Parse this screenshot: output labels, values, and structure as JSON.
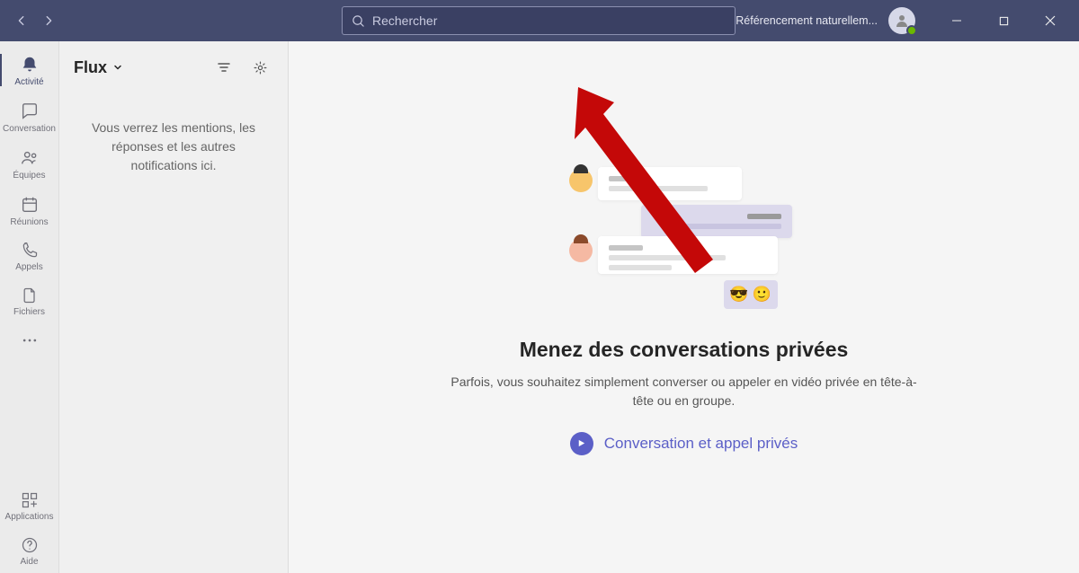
{
  "titlebar": {
    "search_placeholder": "Rechercher",
    "org_name": "Référencement naturellem..."
  },
  "rail": {
    "items": [
      {
        "id": "activity",
        "label": "Activité",
        "active": true
      },
      {
        "id": "chat",
        "label": "Conversation",
        "active": false
      },
      {
        "id": "teams",
        "label": "Équipes",
        "active": false
      },
      {
        "id": "meetings",
        "label": "Réunions",
        "active": false
      },
      {
        "id": "calls",
        "label": "Appels",
        "active": false
      },
      {
        "id": "files",
        "label": "Fichiers",
        "active": false
      }
    ],
    "bottom": [
      {
        "id": "apps",
        "label": "Applications"
      },
      {
        "id": "help",
        "label": "Aide"
      }
    ]
  },
  "panel": {
    "title": "Flux",
    "empty_message": "Vous verrez les mentions, les réponses et les autres notifications ici."
  },
  "hero": {
    "title": "Menez des conversations privées",
    "subtitle": "Parfois, vous souhaitez simplement converser ou appeler en vidéo privée en tête-à-tête ou en groupe.",
    "cta": "Conversation et appel privés"
  }
}
